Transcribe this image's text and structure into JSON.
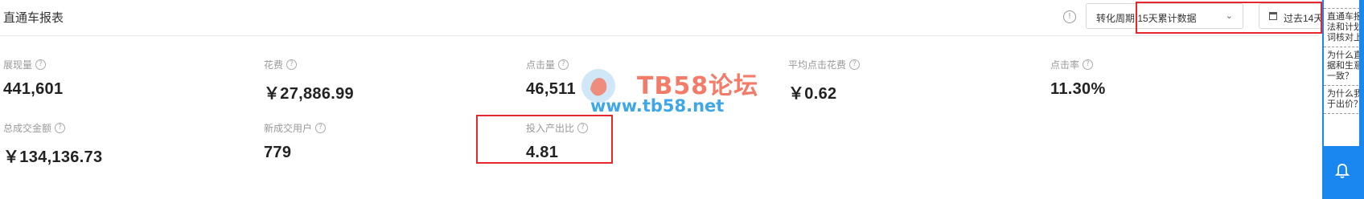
{
  "header": {
    "title": "直通车报表",
    "period_select": "转化周期:15天累计数据",
    "date_button": "过去14天"
  },
  "metrics_row1": [
    {
      "label": "展现量",
      "value": "441,601"
    },
    {
      "label": "花费",
      "value": "￥27,886.99"
    },
    {
      "label": "点击量",
      "value": "46,511"
    },
    {
      "label": "平均点击花费",
      "value": "￥0.62"
    },
    {
      "label": "点击率",
      "value": "11.30%"
    }
  ],
  "metrics_row2": [
    {
      "label": "总成交金额",
      "value": "￥134,136.73"
    },
    {
      "label": "新成交用户",
      "value": "779"
    },
    {
      "label": "投入产出比",
      "value": "4.81"
    }
  ],
  "watermark": {
    "title": "TB58论坛",
    "url": "www.tb58.net"
  },
  "side_panel": {
    "items": [
      "直通车报\n法和计划\n词核对上",
      "为什么直\n据和生意\n一致？",
      "为什么我\n于出价？"
    ]
  },
  "colors": {
    "highlight": "#e8262d",
    "accent": "#1a87f0",
    "wm_title": "#f37b68",
    "wm_url": "#3ea7ea"
  },
  "icons": {
    "info": "info-icon",
    "help": "question-icon",
    "calendar": "calendar-icon",
    "chevron": "chevron-down-icon",
    "bell": "bell-icon"
  }
}
